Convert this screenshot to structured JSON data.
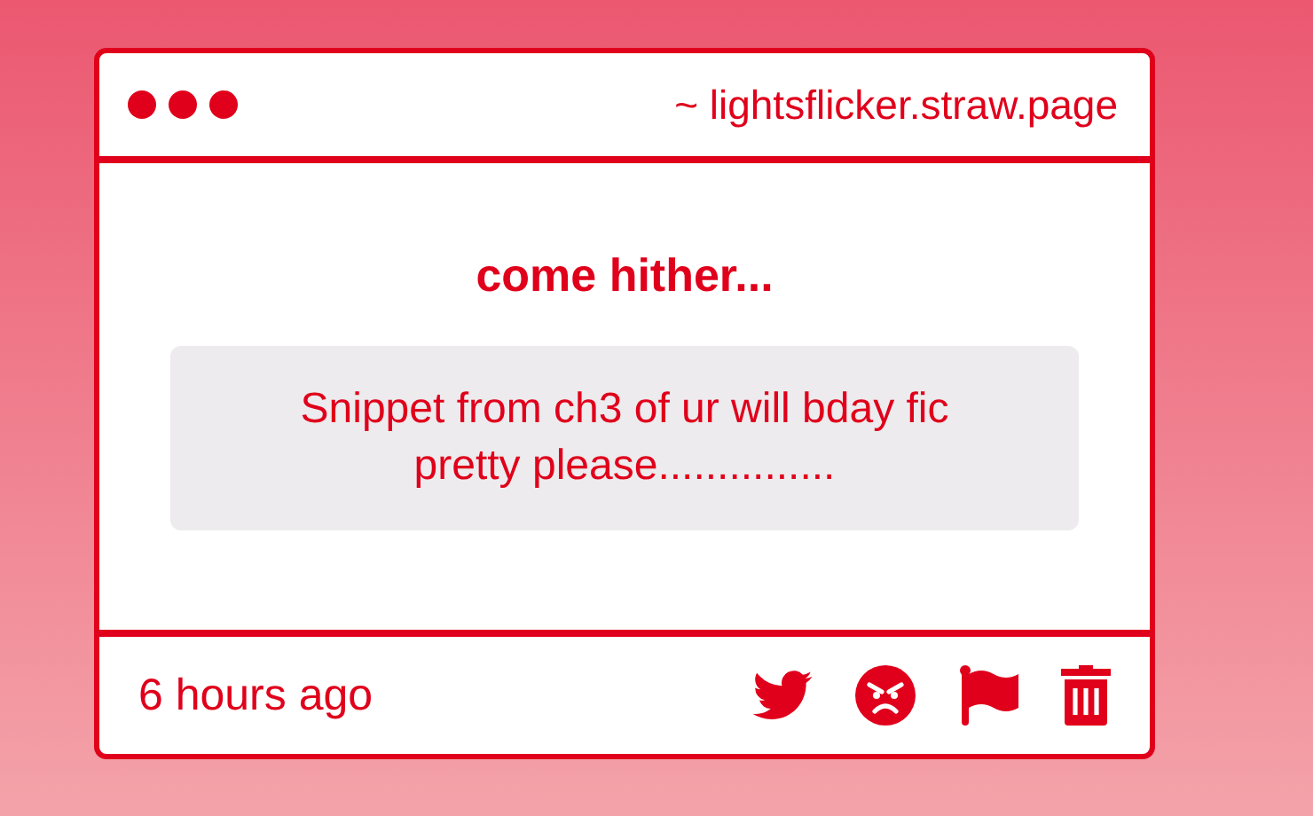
{
  "window": {
    "title": "~ lightsflicker.straw.page"
  },
  "card": {
    "title": "come hither...",
    "message": "Snippet from ch3 of ur will bday fic pretty please..............."
  },
  "footer": {
    "time": "6 hours ago"
  }
}
